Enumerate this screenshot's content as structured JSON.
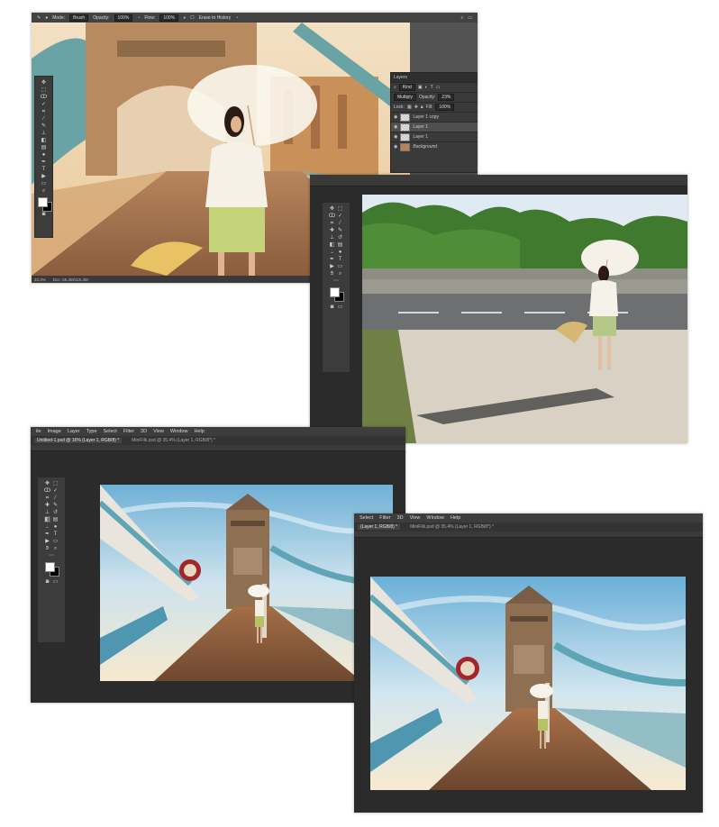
{
  "window1": {
    "options": {
      "mode_label": "Mode:",
      "mode_value": "Brush",
      "opacity_label": "Opacity:",
      "opacity_value": "100%",
      "flow_label": "Flow:",
      "flow_value": "100%",
      "erase_label": "Erase to History"
    },
    "layers_panel": {
      "title": "Layers",
      "kind": "Kind",
      "blend_mode": "Multiply",
      "opacity_label": "Opacity:",
      "opacity_value": "23%",
      "lock_label": "Lock:",
      "fill_label": "Fill:",
      "fill_value": "100%",
      "items": [
        "Layer 1 copy",
        "Layer 1",
        "Layer 1",
        "Background"
      ]
    },
    "status": {
      "zoom": "33.3%",
      "doc": "Doc: 55.3M/115.3M"
    }
  },
  "window3": {
    "menu": [
      "ile",
      "Image",
      "Layer",
      "Type",
      "Select",
      "Filter",
      "3D",
      "View",
      "Window",
      "Help"
    ],
    "tabs": [
      "Untitled-1.psd @ 16% (Layer 1, RGB/8) *",
      "MiniFilk.psd @ 35.4% (Layer 1, RGB/8*) *"
    ]
  },
  "window4": {
    "menu": [
      "Select",
      "Filter",
      "3D",
      "View",
      "Window",
      "Help"
    ],
    "tabs": [
      "(Layer 1, RGB/8) *",
      "MiniFilk.psd @ 35.4% (Layer 1, RGB/8*) *"
    ]
  }
}
